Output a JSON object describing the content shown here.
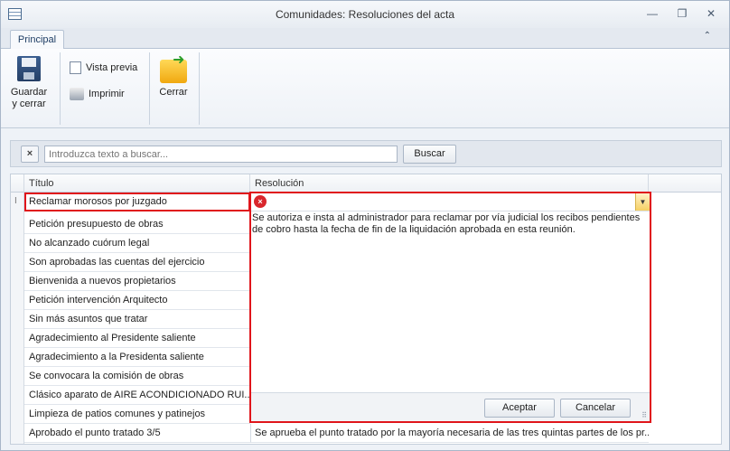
{
  "window": {
    "title": "Comunidades: Resoluciones del acta",
    "minimize": "—",
    "restore": "❐",
    "close": "✕"
  },
  "ribbon": {
    "tab": "Principal",
    "collapse": "⌃",
    "save_label_1": "Guardar",
    "save_label_2": "y cerrar",
    "preview_label": "Vista previa",
    "print_label": "Imprimir",
    "close_label": "Cerrar"
  },
  "search": {
    "clear": "×",
    "placeholder": "Introduzca texto a buscar...",
    "button": "Buscar"
  },
  "grid": {
    "headers": [
      "Título",
      "Resolución"
    ],
    "rows": [
      {
        "titulo": "Reclamar morosos por juzgado",
        "resolucion": ""
      },
      {
        "titulo": "Petición presupuesto de obras",
        "resolucion": ""
      },
      {
        "titulo": "No alcanzado cuórum legal",
        "resolucion": ""
      },
      {
        "titulo": "Son aprobadas las cuentas del ejercicio",
        "resolucion": ""
      },
      {
        "titulo": "Bienvenida a nuevos propietarios",
        "resolucion": ""
      },
      {
        "titulo": "Petición intervención Arquitecto",
        "resolucion": ""
      },
      {
        "titulo": "Sin más asuntos que tratar",
        "resolucion": ""
      },
      {
        "titulo": "Agradecimiento al Presidente saliente",
        "resolucion": ""
      },
      {
        "titulo": "Agradecimiento a la Presidenta saliente",
        "resolucion": ""
      },
      {
        "titulo": "Se convocara la comisión de obras",
        "resolucion": ""
      },
      {
        "titulo": "Clásico aparato de AIRE ACONDICIONADO RUI...",
        "resolucion": ""
      },
      {
        "titulo": "Limpieza de patios comunes y patinejos",
        "resolucion": ""
      },
      {
        "titulo": "Aprobado el punto tratado 3/5",
        "resolucion": "Se aprueba el punto tratado por la mayoría necesaria de las tres quintas partes de los pr..."
      }
    ]
  },
  "popup": {
    "error_glyph": "×",
    "text": "Se autoriza e insta al administrador para reclamar por vía judicial los recibos pendientes de cobro hasta la fecha de fin de la liquidación aprobada en esta reunión.",
    "accept": "Aceptar",
    "cancel": "Cancelar"
  }
}
